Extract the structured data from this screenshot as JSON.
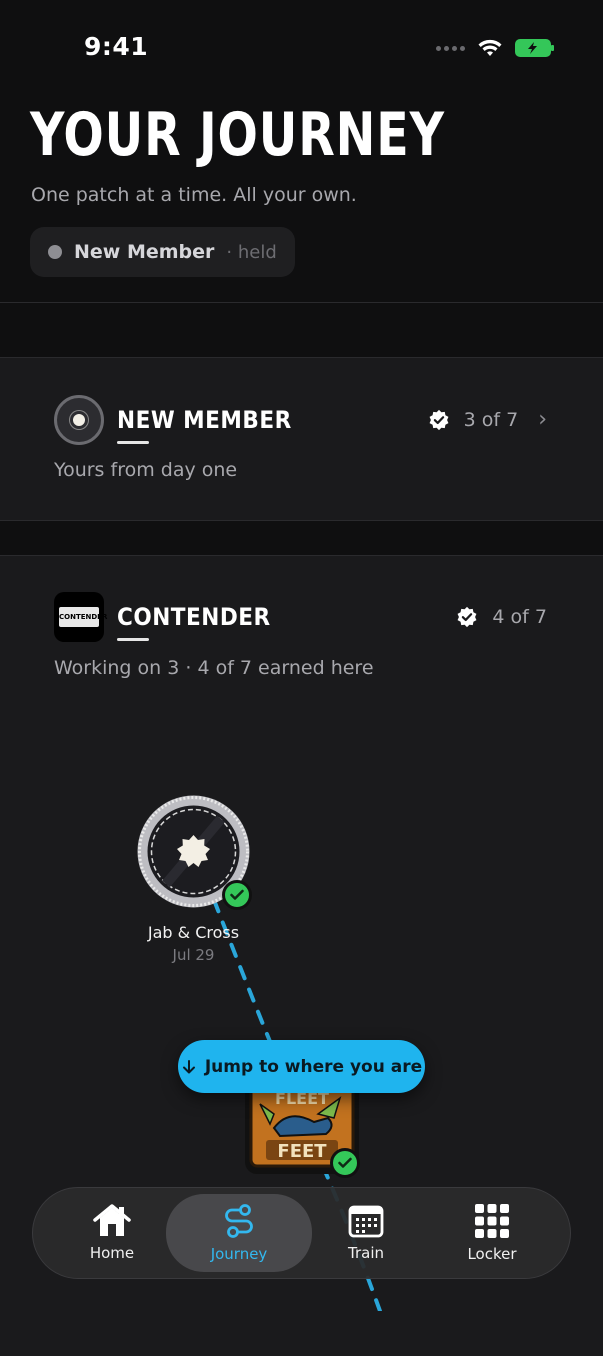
{
  "status_bar": {
    "time": "9:41"
  },
  "header": {
    "title": "YOUR JOURNEY",
    "subtitle": "One patch at a time. All your own.",
    "held_chip": {
      "label": "New Member",
      "status": "· held"
    }
  },
  "levels": [
    {
      "name": "NEW MEMBER",
      "count": "3 of 7",
      "description": "Yours from day one"
    },
    {
      "name": "CONTENDER",
      "count": "4 of 7",
      "description": "Working on 3 · 4 of 7 earned here",
      "badge_text": "CONTENDER"
    }
  ],
  "nodes": [
    {
      "label": "Jab & Cross",
      "date": "Jul 29"
    }
  ],
  "patch": {
    "text_top": "FLEET",
    "text_bottom": "FEET"
  },
  "jump_button": {
    "label": "Jump to where you are"
  },
  "tab_bar": {
    "tabs": [
      {
        "label": "Home",
        "icon": "home-icon"
      },
      {
        "label": "Journey",
        "icon": "journey-icon",
        "active": true
      },
      {
        "label": "Train",
        "icon": "calendar-icon"
      },
      {
        "label": "Locker",
        "icon": "grid-icon"
      }
    ]
  },
  "colors": {
    "accent": "#1fb4ee",
    "success": "#34c759",
    "background": "#0f0f10",
    "card": "#1a1a1c"
  }
}
